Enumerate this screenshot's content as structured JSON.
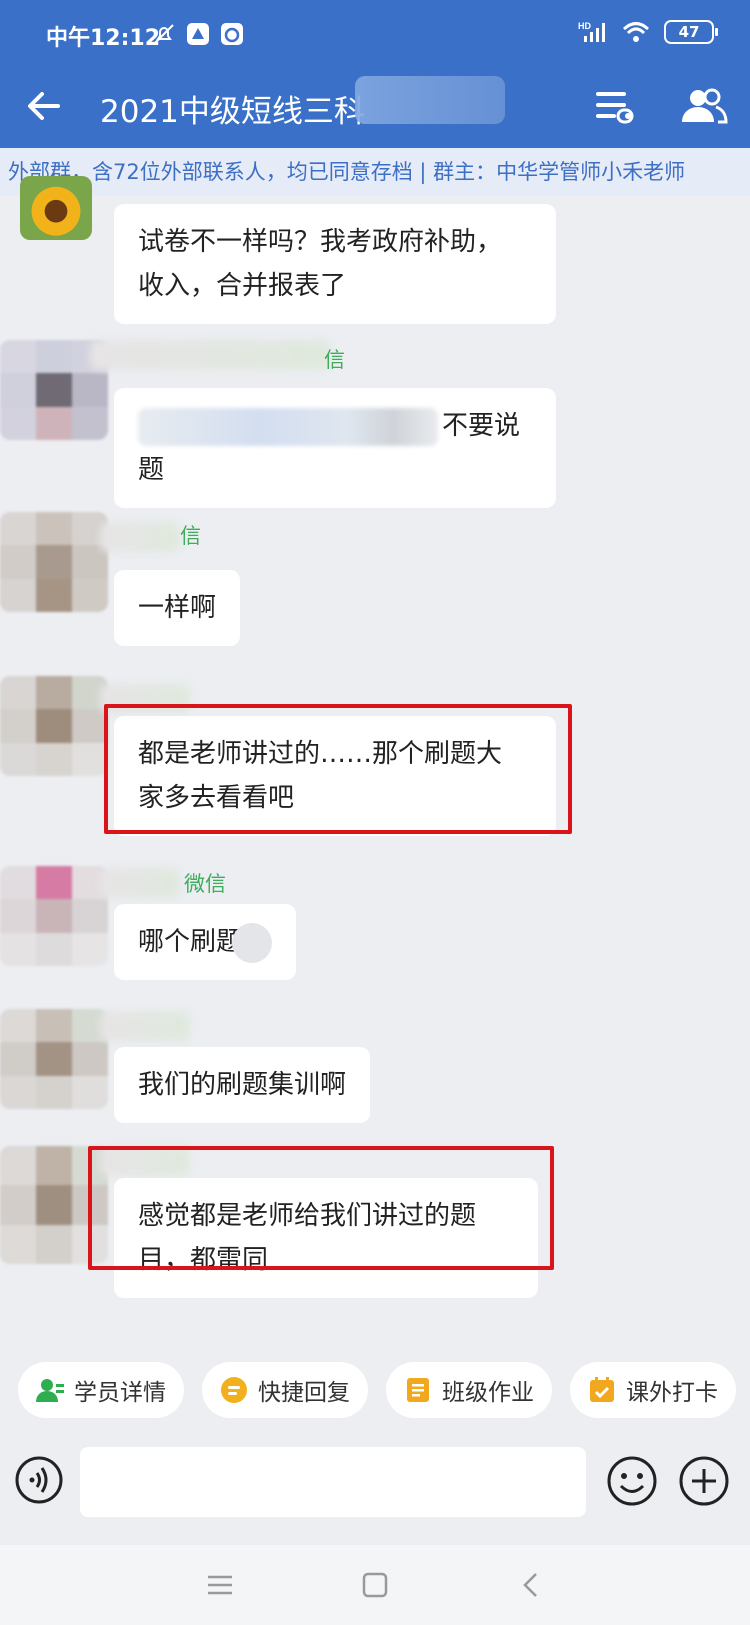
{
  "status_bar": {
    "time": "中午12:12",
    "battery": "47",
    "network": "HD"
  },
  "header": {
    "title": "2021中级短线三科"
  },
  "notice": {
    "text": "外部群，含72位外部联系人，均已同意存档 | 群主：中华学管师小禾老师"
  },
  "messages": [
    {
      "sender_suffix": "",
      "lines": [
        "试卷不一样吗？我考政府补助，",
        "收入，合并报表了"
      ],
      "highlighted": false
    },
    {
      "sender_suffix": "信",
      "lines": [
        "不要说",
        "题"
      ],
      "highlighted": false
    },
    {
      "sender_suffix": "信",
      "lines": [
        "一样啊"
      ],
      "highlighted": false
    },
    {
      "sender_suffix": "",
      "lines": [
        "都是老师讲过的……那个刷题大",
        "家多去看看吧"
      ],
      "highlighted": true
    },
    {
      "sender_suffix": "微信",
      "lines": [
        "哪个刷题"
      ],
      "highlighted": false
    },
    {
      "sender_suffix": "",
      "lines": [
        "我们的刷题集训啊"
      ],
      "highlighted": false
    },
    {
      "sender_suffix": "",
      "lines": [
        "感觉都是老师给我们讲过的题",
        "目，都雷同"
      ],
      "highlighted": true
    }
  ],
  "quick_actions": [
    {
      "label": "学员详情",
      "icon": "user-detail-icon",
      "color": "#2fae4f"
    },
    {
      "label": "快捷回复",
      "icon": "quick-reply-icon",
      "color": "#f2b01e"
    },
    {
      "label": "班级作业",
      "icon": "homework-icon",
      "color": "#f2a81e"
    },
    {
      "label": "课外打卡",
      "icon": "checkin-icon",
      "color": "#f2a81e"
    }
  ],
  "input": {
    "placeholder": ""
  },
  "colors": {
    "header_bg": "#3a70c8",
    "notice_text": "#3d6fc4",
    "sender_name": "#3cae5a",
    "highlight_border": "#d9141b"
  }
}
